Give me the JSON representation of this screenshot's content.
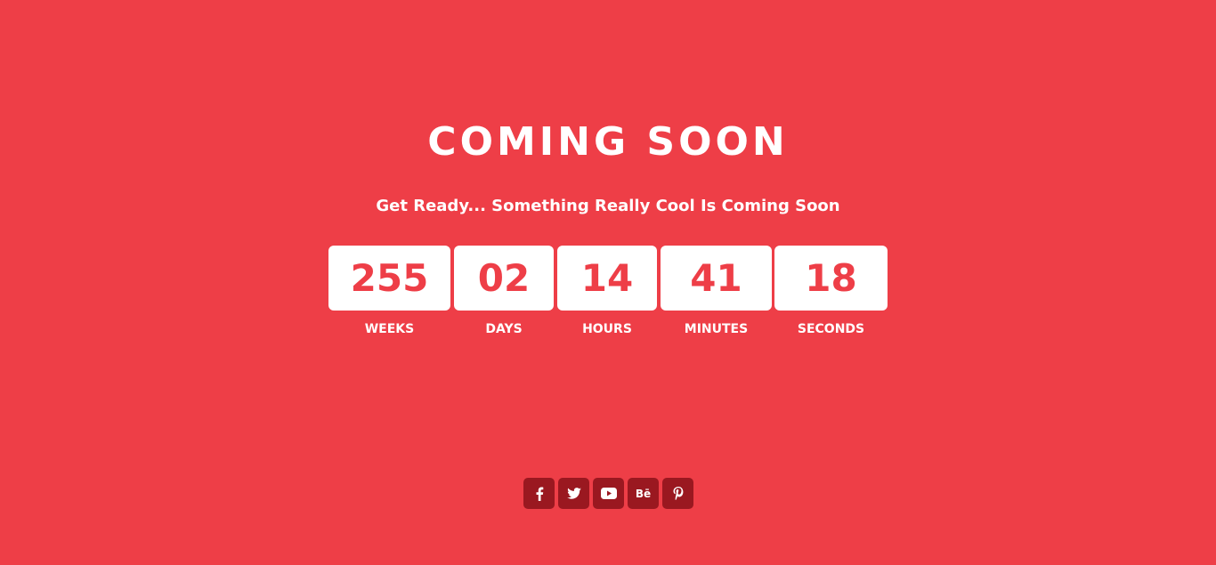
{
  "page": {
    "title": "COMING SOON",
    "subtitle": "Get Ready... Something Really Cool Is Coming Soon"
  },
  "countdown": [
    {
      "value": "255",
      "label": "WEEKS"
    },
    {
      "value": "02",
      "label": "DAYS"
    },
    {
      "value": "14",
      "label": "HOURS"
    },
    {
      "value": "41",
      "label": "MINUTES"
    },
    {
      "value": "18",
      "label": "SECONDS"
    }
  ],
  "social": [
    {
      "icon": "facebook-icon"
    },
    {
      "icon": "twitter-icon"
    },
    {
      "icon": "youtube-icon"
    },
    {
      "icon": "behance-icon",
      "text": "Bē"
    },
    {
      "icon": "pinterest-icon"
    }
  ],
  "colors": {
    "background": "#ee3e47",
    "box": "#ffffff",
    "number": "#ee3e47",
    "social_button": "#9a1820"
  }
}
